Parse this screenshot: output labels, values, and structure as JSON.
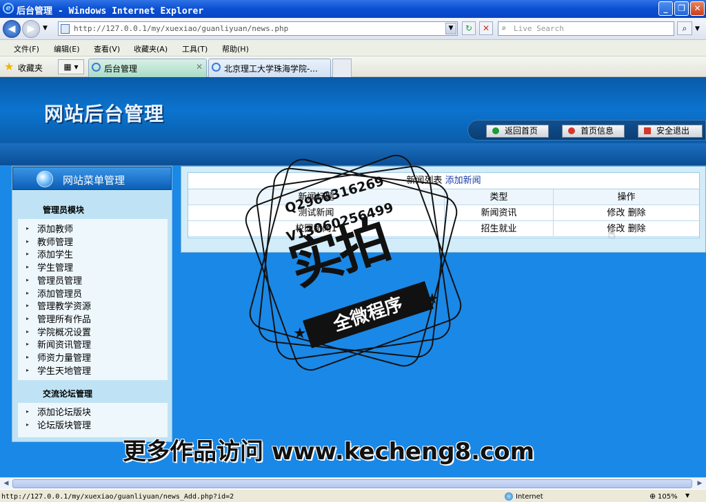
{
  "window": {
    "title": "后台管理 - Windows Internet Explorer",
    "minimize": "_",
    "maximize": "❐",
    "close": "✕"
  },
  "address": {
    "url": "http://127.0.0.1/my/xuexiao/guanliyuan/news.php",
    "search_placeholder": "Live Search"
  },
  "menu": [
    "文件(F)",
    "编辑(E)",
    "查看(V)",
    "收藏夹(A)",
    "工具(T)",
    "帮助(H)"
  ],
  "favorites": {
    "label": "收藏夹"
  },
  "tabs": [
    {
      "label": "后台管理",
      "active": true,
      "close": "✕"
    },
    {
      "label": "北京理工大学珠海学院-...",
      "active": false
    }
  ],
  "site": {
    "logo": "网站后台管理",
    "nav": [
      {
        "label": "返回首页",
        "icon": "refresh-icon",
        "color": "#1f9b3a"
      },
      {
        "label": "首页信息",
        "icon": "pie-icon",
        "color": "#d4372c"
      },
      {
        "label": "安全退出",
        "icon": "close-icon",
        "color": "#d4372c"
      }
    ]
  },
  "sidebar": {
    "title": "网站菜单管理",
    "sections": [
      {
        "title": "管理员模块",
        "items": [
          "添加教师",
          "教师管理",
          "添加学生",
          "学生管理",
          "管理员管理",
          "添加管理员",
          "管理教学资源",
          "管理所有作品",
          "学院概况设置",
          "新闻资讯管理",
          "师资力量管理",
          "学生天地管理"
        ]
      },
      {
        "title": "交流论坛管理",
        "items": [
          "添加论坛版块",
          "论坛版块管理"
        ]
      }
    ]
  },
  "news_list": {
    "caption": "新闻列表",
    "add_link": "添加新闻",
    "headers": [
      "新闻标题",
      "类型",
      "操作"
    ],
    "rows": [
      {
        "title": "测试新闻",
        "type": "新闻资讯",
        "edit": "修改",
        "delete": "删除"
      },
      {
        "title": "校园新闻1",
        "type": "招生就业",
        "edit": "修改",
        "delete": "删除"
      }
    ]
  },
  "watermark": {
    "qq": "Q2966316269",
    "vx": "V13060256499",
    "big": "实拍",
    "banner": "全微程序",
    "promo": "更多作品访问 www.kecheng8.com"
  },
  "status": {
    "url": "http://127.0.0.1/my/xuexiao/guanliyuan/news_Add.php?id=2",
    "zone": "Internet",
    "zoom": "105%"
  }
}
